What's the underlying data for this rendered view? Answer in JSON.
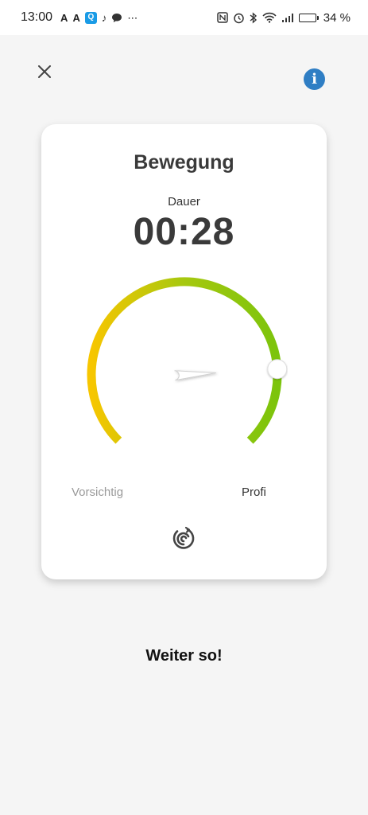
{
  "status_bar": {
    "time": "13:00",
    "battery_percent": "34 %",
    "battery_level": 0.34
  },
  "card": {
    "title": "Bewegung",
    "duration_label": "Dauer",
    "duration_value": "00:28"
  },
  "gauge": {
    "left_label": "Vorsichtig",
    "right_label": "Profi",
    "value_fraction": 0.82,
    "colors": {
      "start": "#f7c600",
      "mid": "#a6c80f",
      "end": "#7cc40c"
    }
  },
  "footer": {
    "message": "Weiter so!"
  },
  "icons": {
    "close": "close-icon",
    "info": "info-icon",
    "spiral": "spiral-icon"
  },
  "colors": {
    "background": "#f5f5f5",
    "info_blue": "#2f7ec4"
  }
}
